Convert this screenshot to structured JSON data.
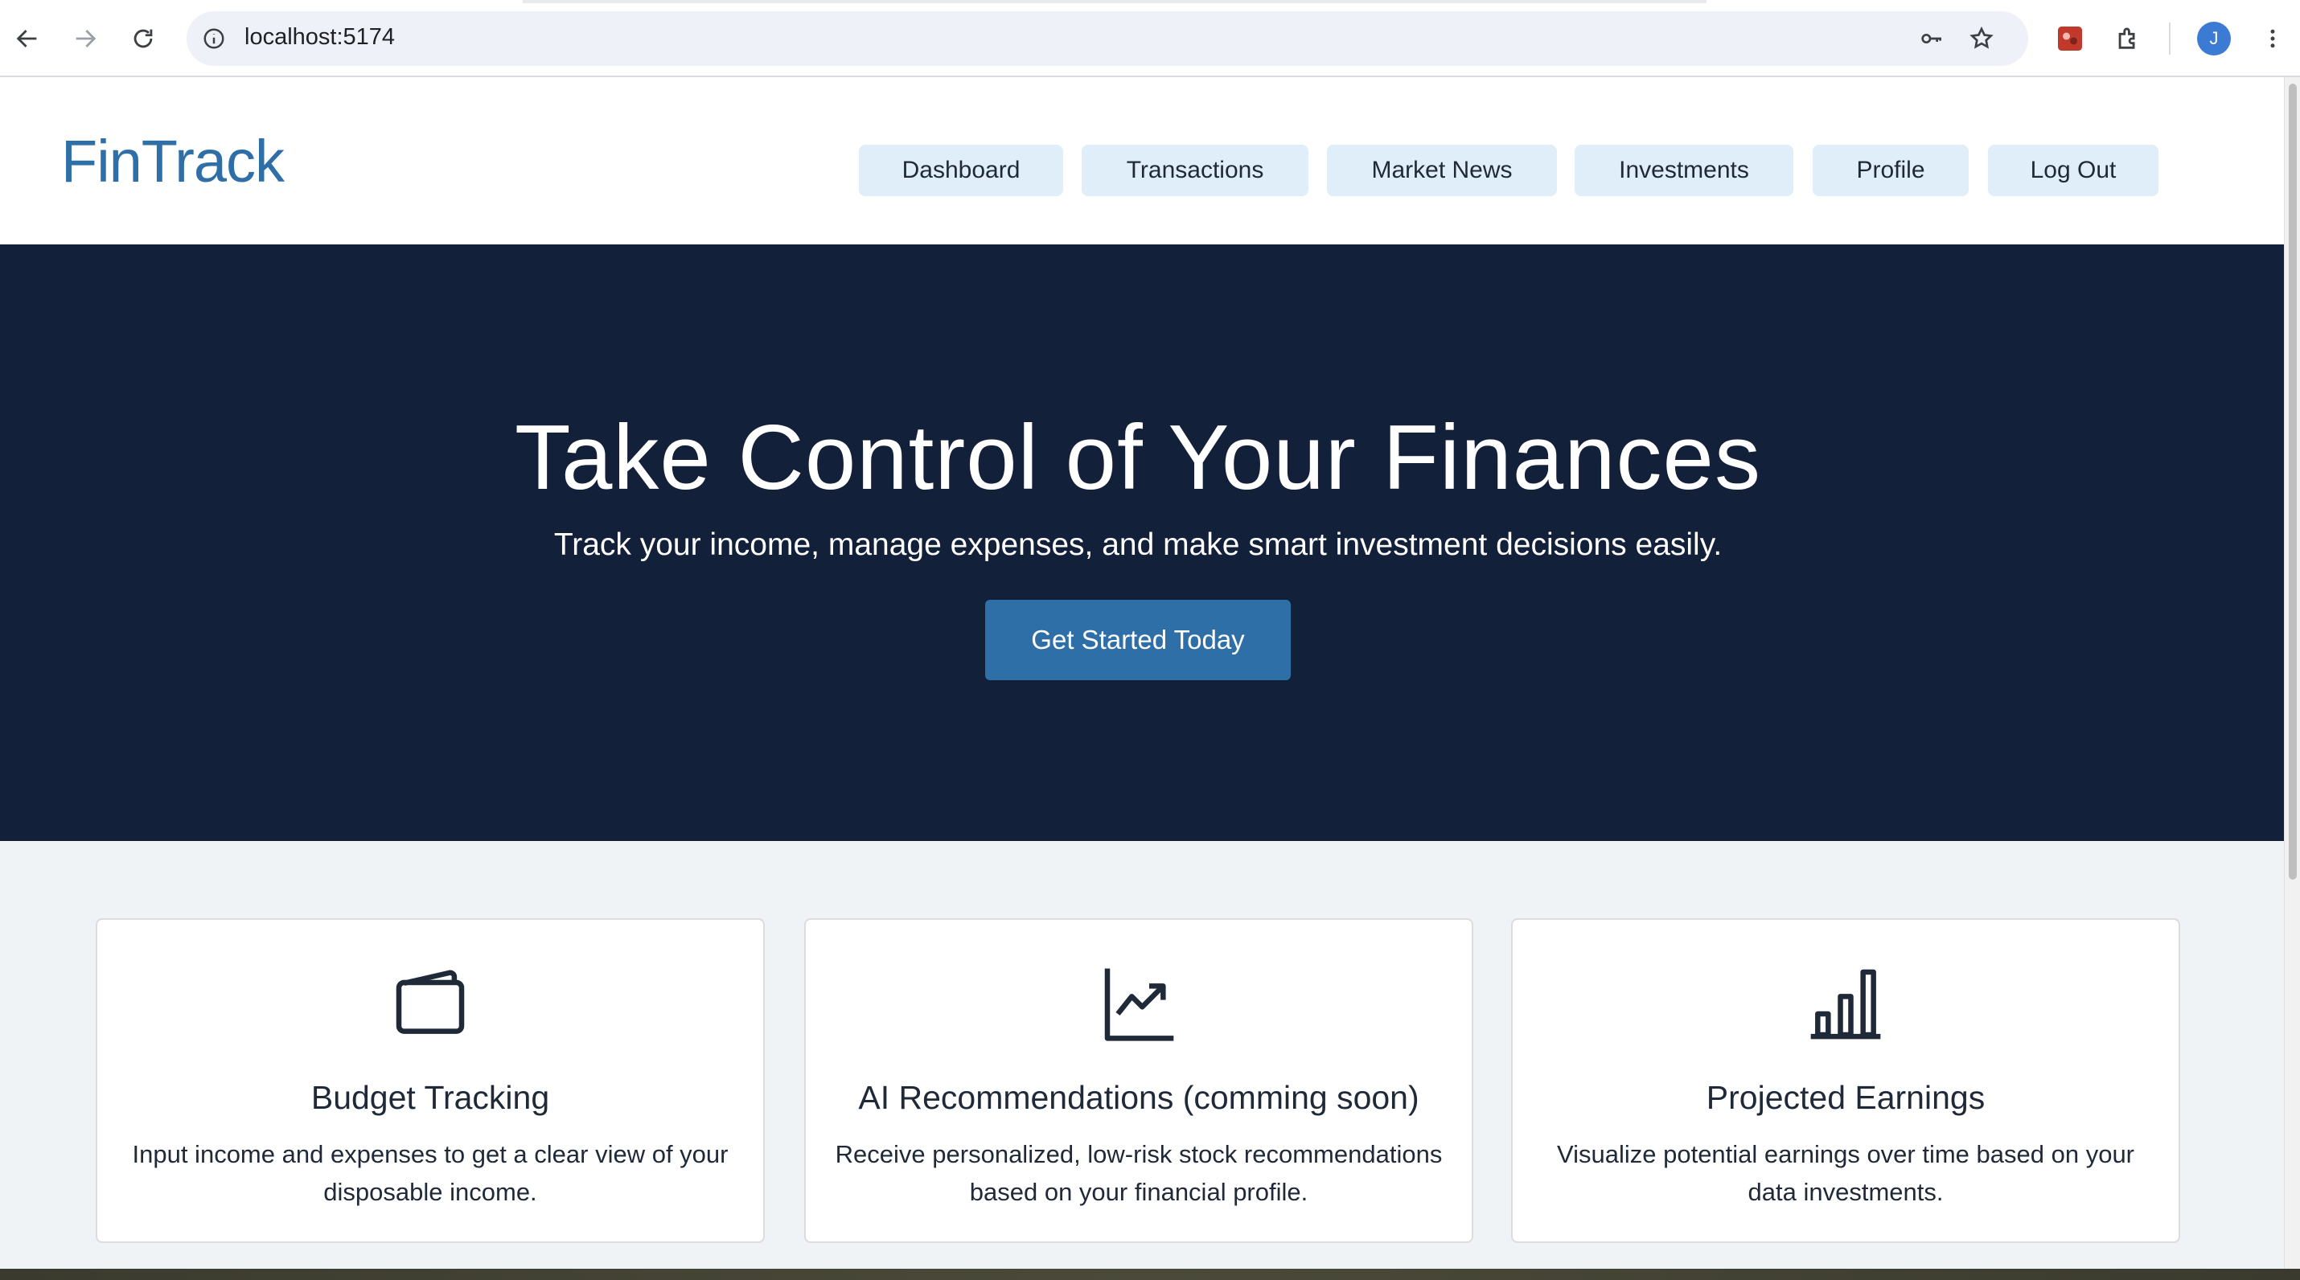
{
  "browser": {
    "url": "localhost:5174",
    "avatar_letter": "J"
  },
  "header": {
    "logo": "FinTrack",
    "nav": [
      {
        "label": "Dashboard"
      },
      {
        "label": "Transactions"
      },
      {
        "label": "Market News"
      },
      {
        "label": "Investments"
      },
      {
        "label": "Profile"
      },
      {
        "label": "Log Out"
      }
    ]
  },
  "hero": {
    "title": "Take Control of Your Finances",
    "subtitle": "Track your income, manage expenses, and make smart investment decisions easily.",
    "cta": "Get Started Today"
  },
  "features": [
    {
      "icon": "wallet-icon",
      "title": "Budget Tracking",
      "text": "Input income and expenses to get a clear view of your disposable income."
    },
    {
      "icon": "trending-up-chart-icon",
      "title": "AI Recommendations (comming soon)",
      "text": "Receive personalized, low-risk stock recommendations based on your financial profile."
    },
    {
      "icon": "bar-chart-icon",
      "title": "Projected Earnings",
      "text": "Visualize potential earnings over time based on your data investments."
    }
  ],
  "colors": {
    "brand": "#2f6fa8",
    "hero_bg": "#132039",
    "nav_bg": "#dfeef8",
    "features_bg": "#eff3f6"
  }
}
